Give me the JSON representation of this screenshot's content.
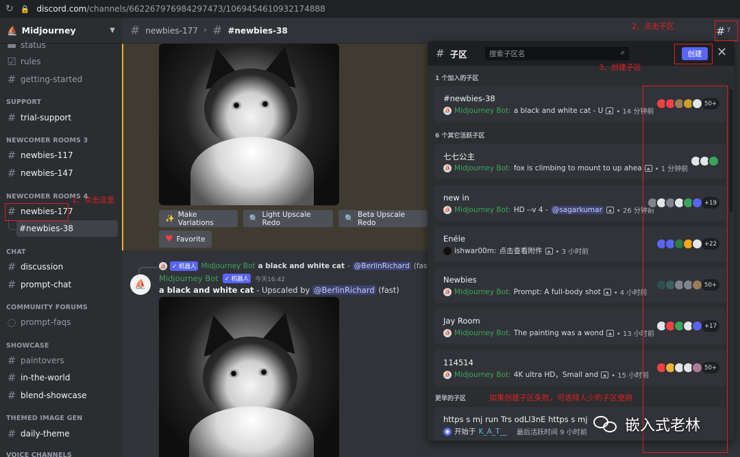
{
  "browser": {
    "url_host": "discord.com",
    "url_path": "/channels/662267976984297473/1069454610932174888"
  },
  "sidebar": {
    "server_name": "Midjourney",
    "top_items": [
      "status",
      "rules",
      "getting-started"
    ],
    "cat_support": "SUPPORT",
    "trial_support": "trial-support",
    "cat_newcomer3": "NEWCOMER ROOMS 3",
    "newbies117": "newbies-117",
    "newbies147": "newbies-147",
    "cat_newcomer4": "NEWCOMER ROOMS 4",
    "newbies177": "newbies-177",
    "thread_newbies38": "#newbies-38",
    "cat_chat": "CHAT",
    "discussion": "discussion",
    "prompt_chat": "prompt-chat",
    "cat_forums": "COMMUNITY FORUMS",
    "prompt_faqs": "prompt-faqs",
    "cat_showcase": "SHOWCASE",
    "paintovers": "paintovers",
    "in_the_world": "in-the-world",
    "blend_showcase": "blend-showcase",
    "cat_themed": "THEMED IMAGE GEN",
    "daily_theme": "daily-theme",
    "cat_voice": "VOICE CHANNELS"
  },
  "topbar": {
    "parent": "newbies-177",
    "current": "#newbies-38",
    "threads_count": "7"
  },
  "chat": {
    "buttons": [
      "Make Variations",
      "Light Upscale Redo",
      "Beta Upscale Redo"
    ],
    "favorite": "Favorite",
    "reply_bot": "机器人",
    "reply_author": "Midjourney Bot",
    "reply_text": "a black and white cat",
    "reply_dash": " - ",
    "reply_mention": "@BerlinRichard",
    "reply_fast": "(fast)",
    "author": "Midjourney Bot",
    "bot_tag": "机器人",
    "time": "今天16:42",
    "body_bold": "a black and white cat",
    "body_mid": " - Upscaled by ",
    "body_mention": "@BerlinRichard",
    "body_end": " (fast)"
  },
  "threads_panel": {
    "title": "子区",
    "search_placeholder": "搜索子区名",
    "create": "创建",
    "section_joined": "1 个加入的子区",
    "section_active": "6 个其它活跃子区",
    "section_older": "更早的子区",
    "threads": [
      {
        "name": "#newbies-38",
        "author": "Midjourney Bot:",
        "text": "a black and white cat - U",
        "meta": "• 14 分钟前",
        "count": "50+",
        "avatars": [
          "#ed4245",
          "#ed4245",
          "#9a7b5a",
          "#c9a227",
          "#e3e5e8"
        ]
      },
      {
        "name": "七七公主",
        "author": "Midjourney Bot:",
        "text": "fox is climbing to mount to up ahea",
        "meta": "• 1 分钟前",
        "count": "",
        "avatars": [
          "#e3e5e8",
          "#e3e5e8",
          "#3ba55c"
        ]
      },
      {
        "name": "new in",
        "author": "Midjourney Bot:",
        "text": "HD --v 4 -",
        "mention": "@sagarkumar",
        "meta": "• 26 分钟前",
        "count": "+19",
        "avatars": [
          "#80848e",
          "#e3e5e8",
          "#80848e",
          "#e3e5e8",
          "#3ba55c",
          "#5865f2"
        ]
      },
      {
        "name": "Enéle",
        "author": "ishwar00m:",
        "text": "点击查看附件",
        "meta": "• 3 小时前",
        "count": "+22",
        "avatars": [
          "#5865f2",
          "#5865f2",
          "#2d7d46",
          "#faa61a",
          "#e3e5e8"
        ]
      },
      {
        "name": "Newbies",
        "author": "Midjourney Bot:",
        "text": "Prompt: A full-body shot",
        "meta": "• 4 小时前",
        "count": "50+",
        "avatars": [
          "#2f4f4f",
          "#3a5f5f",
          "#80848e",
          "#80848e",
          "#9a7b5a"
        ]
      },
      {
        "name": "Jay Room",
        "author": "Midjourney Bot:",
        "text": "The painting was a wond",
        "meta": "• 13 小时前",
        "count": "+17",
        "avatars": [
          "#e3e5e8",
          "#ed4245",
          "#3ba55c",
          "#e3e5e8",
          "#5865f2"
        ]
      },
      {
        "name": "114514",
        "author": "Midjourney Bot:",
        "text": "4K ultra HD，Small and",
        "meta": "• 15 小时前",
        "count": "50+",
        "avatars": [
          "#ed4245",
          "#f0b232",
          "#e3e5e8",
          "#e3e5e8",
          "#b07a9a"
        ]
      }
    ],
    "older": {
      "name": "https s mj run Trs odLl3nE https s mj",
      "started_by": "开始于",
      "starter": "K_A_T__",
      "meta": "最后活跃时间 9 小时前"
    }
  },
  "annotations": {
    "step1": "1、点击这里",
    "step2": "2、点击子区",
    "step3": "3、创建子区",
    "note": "如果创建子区失败，可选择人少的子区使用"
  },
  "watermark": "嵌入式老林",
  "colors": {
    "accent": "#5865f2",
    "bot_green": "#3ba55c",
    "annotation_red": "#e02020",
    "highlight": "#f0b232"
  }
}
